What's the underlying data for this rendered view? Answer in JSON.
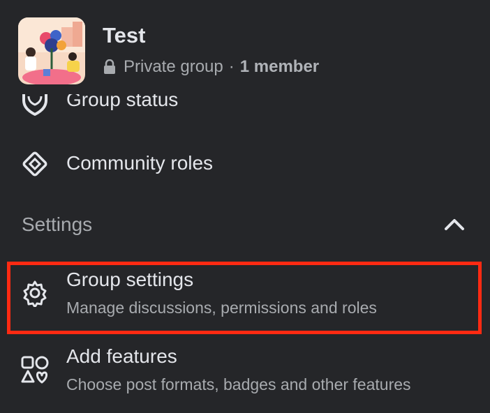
{
  "group": {
    "name": "Test",
    "privacy": "Private group",
    "separator": "·",
    "members": "1 member"
  },
  "menu": {
    "group_status": {
      "label": "Group status"
    },
    "community_roles": {
      "label": "Community roles"
    }
  },
  "settings": {
    "section_title": "Settings",
    "items": [
      {
        "title": "Group settings",
        "subtitle": "Manage discussions, permissions and roles"
      },
      {
        "title": "Add features",
        "subtitle": "Choose post formats, badges and other features"
      }
    ]
  },
  "colors": {
    "background": "#252629",
    "primary_text": "#e4e6eb",
    "secondary_text": "#a8abaf",
    "highlight_border": "#ff2a12"
  }
}
